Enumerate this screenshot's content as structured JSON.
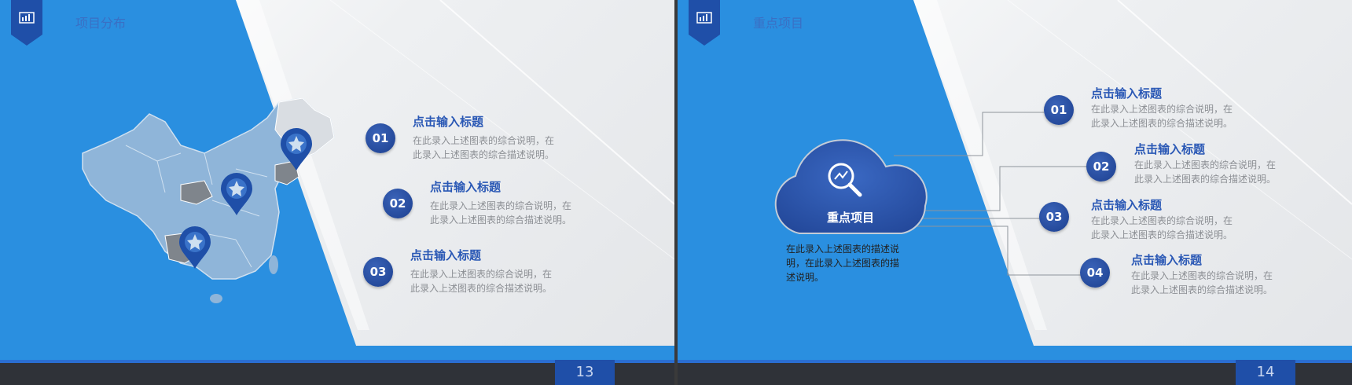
{
  "slides": [
    {
      "title": "项目分布",
      "page_number": "13",
      "items": [
        {
          "num": "01",
          "title": "点击输入标题",
          "desc_line1": "在此录入上述图表的综合说明，在",
          "desc_line2": "此录入上述图表的综合描述说明。"
        },
        {
          "num": "02",
          "title": "点击输入标题",
          "desc_line1": "在此录入上述图表的综合说明，在",
          "desc_line2": "此录入上述图表的综合描述说明。"
        },
        {
          "num": "03",
          "title": "点击输入标题",
          "desc_line1": "在此录入上述图表的综合说明，在",
          "desc_line2": "此录入上述图表的综合描述说明。"
        }
      ]
    },
    {
      "title": "重点项目",
      "page_number": "14",
      "cloud": {
        "label": "重点项目",
        "desc_line1": "在此录入上述图表的描述说",
        "desc_line2": "明，在此录入上述图表的描",
        "desc_line3": "述说明。"
      },
      "items": [
        {
          "num": "01",
          "title": "点击输入标题",
          "desc_line1": "在此录入上述图表的综合说明，在",
          "desc_line2": "此录入上述图表的综合描述说明。"
        },
        {
          "num": "02",
          "title": "点击输入标题",
          "desc_line1": "在此录入上述图表的综合说明，在",
          "desc_line2": "此录入上述图表的综合描述说明。"
        },
        {
          "num": "03",
          "title": "点击输入标题",
          "desc_line1": "在此录入上述图表的综合说明，在",
          "desc_line2": "此录入上述图表的综合描述说明。"
        },
        {
          "num": "04",
          "title": "点击输入标题",
          "desc_line1": "在此录入上述图表的综合说明，在",
          "desc_line2": "此录入上述图表的综合描述说明。"
        }
      ]
    }
  ],
  "colors": {
    "accent_blue": "#2a8fe0",
    "dark_blue": "#1f4fa8",
    "title_blue": "#2a58b5",
    "map_blue": "#8fb5d9"
  },
  "icons": {
    "badge": "chart-board-icon",
    "pin": "star-pin-icon",
    "cloud_center": "magnifier-chart-icon"
  }
}
